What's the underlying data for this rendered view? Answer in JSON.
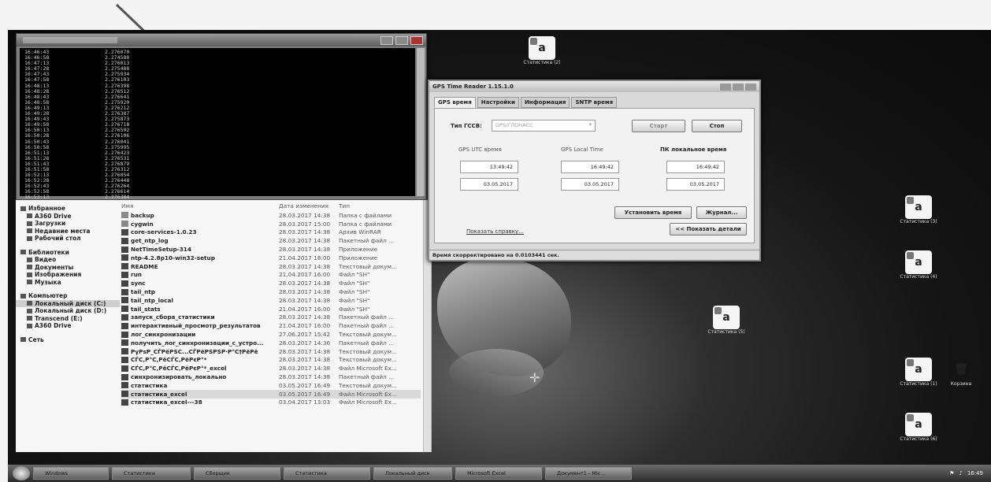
{
  "console": {
    "rows": [
      {
        "t": "16:46:43",
        "v": "2.276070"
      },
      {
        "t": "16:46:58",
        "v": "2.274588"
      },
      {
        "t": "16:47:13",
        "v": "2.276013"
      },
      {
        "t": "16:47:28",
        "v": "2.275488"
      },
      {
        "t": "16:47:43",
        "v": "2.275934"
      },
      {
        "t": "16:47:58",
        "v": "2.276103"
      },
      {
        "t": "16:48:13",
        "v": "2.276398"
      },
      {
        "t": "16:48:28",
        "v": "2.276512"
      },
      {
        "t": "16:48:43",
        "v": "2.276641"
      },
      {
        "t": "16:48:58",
        "v": "2.275920"
      },
      {
        "t": "16:49:13",
        "v": "2.276212"
      },
      {
        "t": "16:49:28",
        "v": "2.276387"
      },
      {
        "t": "16:49:43",
        "v": "2.275873"
      },
      {
        "t": "16:49:58",
        "v": "2.276718"
      },
      {
        "t": "16:50:13",
        "v": "2.276592"
      },
      {
        "t": "16:50:28",
        "v": "2.276106"
      },
      {
        "t": "16:50:43",
        "v": "2.276041"
      },
      {
        "t": "16:50:58",
        "v": "2.275995"
      },
      {
        "t": "16:51:13",
        "v": "2.276423"
      },
      {
        "t": "16:51:28",
        "v": "2.276531"
      },
      {
        "t": "16:51:43",
        "v": "2.276879"
      },
      {
        "t": "16:51:58",
        "v": "2.276312"
      },
      {
        "t": "16:52:13",
        "v": "2.276054"
      },
      {
        "t": "16:52:28",
        "v": "2.276448"
      },
      {
        "t": "16:52:43",
        "v": "2.276264"
      },
      {
        "t": "16:52:58",
        "v": "2.276614"
      },
      {
        "t": "16:53:13",
        "v": "2.276384"
      }
    ]
  },
  "explorer": {
    "nav": [
      {
        "label": "Избранное",
        "sub": false
      },
      {
        "label": "A360 Drive",
        "sub": true
      },
      {
        "label": "Загрузки",
        "sub": true
      },
      {
        "label": "Недавние места",
        "sub": true
      },
      {
        "label": "Рабочий стол",
        "sub": true
      },
      {
        "label": "",
        "gap": true
      },
      {
        "label": "Библиотеки",
        "sub": false
      },
      {
        "label": "Видео",
        "sub": true
      },
      {
        "label": "Документы",
        "sub": true
      },
      {
        "label": "Изображения",
        "sub": true
      },
      {
        "label": "Музыка",
        "sub": true
      },
      {
        "label": "",
        "gap": true
      },
      {
        "label": "Компьютер",
        "sub": false
      },
      {
        "label": "Локальный диск (C:)",
        "sub": true,
        "selected": true
      },
      {
        "label": "Локальный диск (D:)",
        "sub": true
      },
      {
        "label": "Transcend (E:)",
        "sub": true
      },
      {
        "label": "A360 Drive",
        "sub": true
      },
      {
        "label": "",
        "gap": true
      },
      {
        "label": "Сеть",
        "sub": false
      }
    ],
    "headers": {
      "name": "Имя",
      "date": "Дата изменения",
      "type": "Тип"
    },
    "files": [
      {
        "name": "backup",
        "date": "28.03.2017 14:38",
        "type": "Папка с файлами",
        "kind": "folder"
      },
      {
        "name": "cygwin",
        "date": "28.03.2017 15:00",
        "type": "Папка с файлами",
        "kind": "folder"
      },
      {
        "name": "core-services-1.0.23",
        "date": "28.03.2017 14:38",
        "type": "Архив WinRAR",
        "kind": "file"
      },
      {
        "name": "get_ntp_log",
        "date": "28.03.2017 14:38",
        "type": "Пакетный файл ...",
        "kind": "file"
      },
      {
        "name": "NetTimeSetup-314",
        "date": "28.03.2017 14:38",
        "type": "Приложение",
        "kind": "file"
      },
      {
        "name": "ntp-4.2.8p10-win32-setup",
        "date": "21.04.2017 18:00",
        "type": "Приложение",
        "kind": "file"
      },
      {
        "name": "README",
        "date": "28.03.2017 14:38",
        "type": "Текстовый докум...",
        "kind": "file"
      },
      {
        "name": "run",
        "date": "21.04.2017 16:00",
        "type": "Файл \"SH\"",
        "kind": "file"
      },
      {
        "name": "sync",
        "date": "28.03.2017 14:38",
        "type": "Файл \"SH\"",
        "kind": "file"
      },
      {
        "name": "tail_ntp",
        "date": "28.03.2017 14:38",
        "type": "Файл \"SH\"",
        "kind": "file"
      },
      {
        "name": "tail_ntp_local",
        "date": "28.03.2017 14:38",
        "type": "Файл \"SH\"",
        "kind": "file"
      },
      {
        "name": "tail_stats",
        "date": "21.04.2017 16:00",
        "type": "Файл \"SH\"",
        "kind": "file"
      },
      {
        "name": "запуск_сбора_статистики",
        "date": "28.03.2017 14:38",
        "type": "Пакетный файл ...",
        "kind": "file"
      },
      {
        "name": "интерактивный_просмотр_результатов",
        "date": "21.04.2017 16:00",
        "type": "Пакетный файл ...",
        "kind": "file"
      },
      {
        "name": "лог_синхронизации",
        "date": "27.06.2017 15:42",
        "type": "Текстовый докум...",
        "kind": "file"
      },
      {
        "name": "получить_лог_синхронизации_с_устро...",
        "date": "28.03.2017 14:36",
        "type": "Пакетный файл ...",
        "kind": "file"
      },
      {
        "name": "РұРѕР_СЃРёРЅС...СЃРёРЅРЅР·Р°С†РёРё",
        "date": "28.03.2017 14:38",
        "type": "Текстовый докум...",
        "kind": "file"
      },
      {
        "name": "СЃС‚Р°С‚РёСЃС‚РёРєР°*",
        "date": "28.03.2017 14:38",
        "type": "Текстовый докум...",
        "kind": "file"
      },
      {
        "name": "СЃС‚Р°С‚РёСЃС‚РёРєР°*_excel",
        "date": "28.03.2017 14:38",
        "type": "Файл Microsoft Ex...",
        "kind": "file"
      },
      {
        "name": "синхронизировать_локально",
        "date": "28.03.2017 14:38",
        "type": "Пакетный файл ...",
        "kind": "file"
      },
      {
        "name": "статистика",
        "date": "03.05.2017 16:49",
        "type": "Текстовый докум...",
        "kind": "file"
      },
      {
        "name": "статистика_excel",
        "date": "03.05.2017 16:49",
        "type": "Файл Microsoft Ex...",
        "kind": "file",
        "selected": true
      },
      {
        "name": "статистика_excel---38",
        "date": "03.04.2017 13:03",
        "type": "Файл Microsoft Ex...",
        "kind": "file"
      }
    ]
  },
  "gps": {
    "title": "GPS Time Reader 1.15.1.0",
    "tabs": [
      "GPS время",
      "Настройки",
      "Информация",
      "SNTP время"
    ],
    "gnss_label": "Тип ГССВ:",
    "gnss_value": "GPS/ГЛОНАСС",
    "start": "Старт",
    "stop": "Стоп",
    "utc_label": "GPS UTC время",
    "local_label": "GPS Local Time",
    "pc_label": "ПК локальное время",
    "utc_time": "13:49:42",
    "utc_date": "03.05.2017",
    "local_time": "16:49:42",
    "local_date": "03.05.2017",
    "pc_time": "16:49:42",
    "pc_date": "03.05.2017",
    "set_time": "Установить время",
    "journal": "Журнал...",
    "help_link": "Показать справку...",
    "hide_details": "<< Показать детали",
    "status": "Время скорректировано на 0.0103441 сек."
  },
  "desktop_icons": [
    {
      "label": "Статистика (2)",
      "glyph": "a"
    },
    {
      "label": "Статистика (3)",
      "glyph": "a"
    },
    {
      "label": "Статистика (4)",
      "glyph": "a"
    },
    {
      "label": "Статистика (5)",
      "glyph": "a"
    },
    {
      "label": "Статистика (1)",
      "glyph": "a"
    },
    {
      "label": "Статистика (6)",
      "glyph": "a"
    },
    {
      "label": "Корзина",
      "glyph": "🗑"
    }
  ],
  "taskbar": {
    "items": [
      "Windows",
      "Статистика",
      "Сборщик",
      "Статистика",
      "Локальный диск",
      "Microsoft Excel",
      "Документ1 - Mic..."
    ],
    "clock": "16:49"
  }
}
